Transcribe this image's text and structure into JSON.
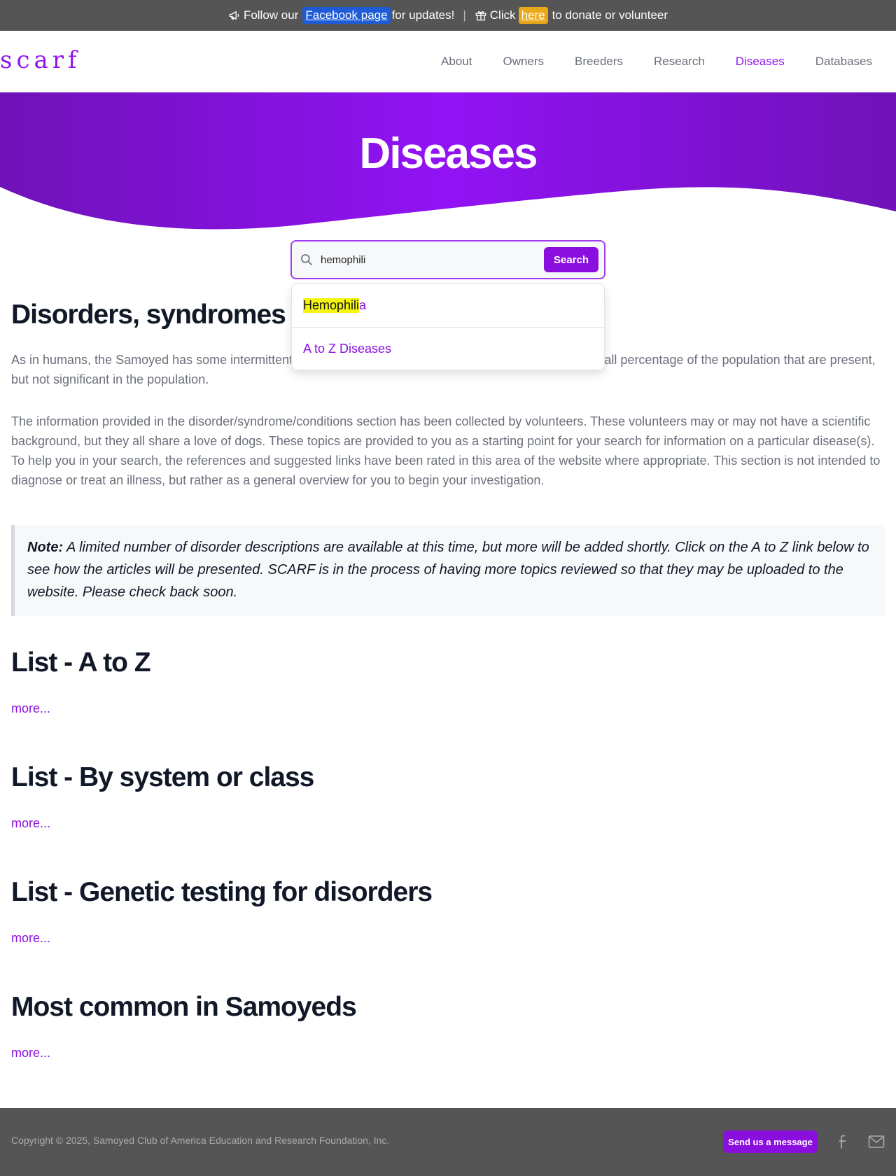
{
  "announcement": {
    "follow_text": "Follow our",
    "facebook_link": "Facebook page",
    "updates_text": "for updates!",
    "separator": "|",
    "click_text": "Click",
    "here_link": "here",
    "donate_text": "to donate or volunteer",
    "icons": [
      "megaphone-icon",
      "gift-icon"
    ]
  },
  "nav": {
    "logo": "scarf",
    "links": [
      {
        "label": "About"
      },
      {
        "label": "Owners"
      },
      {
        "label": "Breeders"
      },
      {
        "label": "Research"
      },
      {
        "label": "Diseases",
        "active": true
      },
      {
        "label": "Databases"
      }
    ]
  },
  "hero": {
    "title": "Diseases",
    "colors": {
      "gradient_start": "#6f12b8",
      "gradient_mid": "#9212f5",
      "gradient_end": "#6f12b8"
    }
  },
  "search": {
    "value": "hemophili",
    "button_label": "Search",
    "suggestions": [
      {
        "match": "Hemophili",
        "rest": "a"
      },
      {
        "label": "A to Z Diseases"
      }
    ]
  },
  "content": {
    "heading": "Disorders, syndromes and conditions",
    "para1": "As in humans, the Samoyed has some intermittent disorders, syndromes and conditions that occur in a small percentage of the population that are present, but not significant in the population.",
    "para2": "The information provided in the disorder/syndrome/conditions section has been collected by volunteers. These volunteers may or may not have a scientific background, but they all share a love of dogs. These topics are provided to you as a starting point for your search for information on a particular disease(s). To help you in your search, the references and suggested links have been rated in this area of the website where appropriate. This section is not intended to diagnose or treat an illness, but rather as a general overview for you to begin your investigation.",
    "note_label": "Note:",
    "note_text": "A limited number of disorder descriptions are available at this time, but more will be added shortly. Click on the A to Z link below to see how the articles will be presented. SCARF is in the process of having more topics reviewed so that they may be uploaded to the website. Please check back soon.",
    "sections": [
      {
        "title": "List - A to Z",
        "more": "more..."
      },
      {
        "title": "List - By system or class",
        "more": "more..."
      },
      {
        "title": "List - Genetic testing for disorders",
        "more": "more..."
      },
      {
        "title": "Most common in Samoyeds",
        "more": "more..."
      }
    ]
  },
  "footer": {
    "copyright": "Copyright © 2025, Samoyed Club of America Education and Research Foundation, Inc.",
    "message_button": "Send us a message",
    "icons": [
      "facebook-icon",
      "mail-icon"
    ]
  },
  "colors": {
    "accent": "#8a0fdf",
    "banner_bg": "#555555",
    "facebook_blue": "#1d5cd6",
    "donate_yellow": "#e8a817",
    "highlight": "#f5f512"
  }
}
